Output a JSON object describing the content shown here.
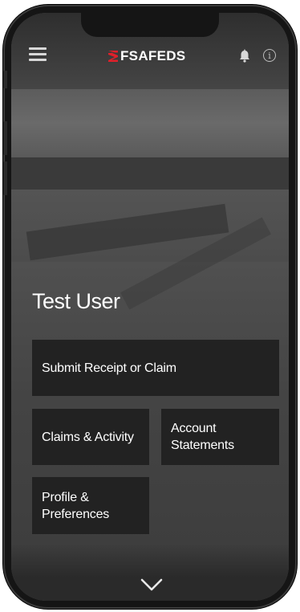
{
  "header": {
    "logo_text": "FSAFEDS",
    "menu_icon": "hamburger-menu-icon",
    "notification_icon": "bell-icon",
    "info_icon": "info-icon",
    "info_glyph": "i"
  },
  "user": {
    "name": "Test User"
  },
  "tiles": {
    "submit": "Submit Receipt or Claim",
    "claims": "Claims & Activity",
    "account": "Account Statements",
    "profile": "Profile & Preferences"
  },
  "footer": {
    "scroll_icon": "chevron-down-icon"
  },
  "colors": {
    "tile_bg": "#222222",
    "text": "#ffffff",
    "logo_accent": "#e0202a"
  }
}
